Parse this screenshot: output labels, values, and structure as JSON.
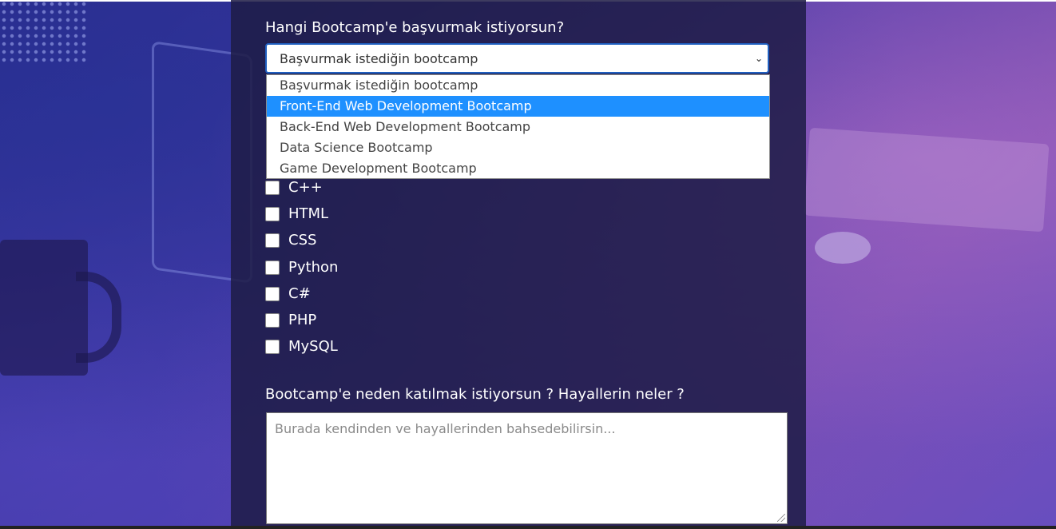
{
  "form": {
    "bootcamp_question": "Hangi Bootcamp'e başvurmak istiyorsun?",
    "bootcamp_select": {
      "selected": "Başvurmak istediğin bootcamp",
      "options": [
        "Başvurmak istediğin bootcamp",
        "Front-End Web Development Bootcamp",
        "Back-End Web Development Bootcamp",
        "Data Science Bootcamp",
        "Game Development Bootcamp"
      ],
      "highlighted_index": 1
    },
    "languages": [
      "C++",
      "HTML",
      "CSS",
      "Python",
      "C#",
      "PHP",
      "MySQL"
    ],
    "why_question": "Bootcamp'e neden katılmak istiyorsun ? Hayallerin neler ?",
    "why_placeholder": "Burada kendinden ve hayallerinden bahsedebilirsin..."
  },
  "icons": {
    "select_chevron": "chevron-down-icon",
    "resize_grip": "resize-grip-icon"
  },
  "colors": {
    "panel": "#1e1c46",
    "highlight": "#1e90ff",
    "select_border": "#1f5fbf"
  }
}
